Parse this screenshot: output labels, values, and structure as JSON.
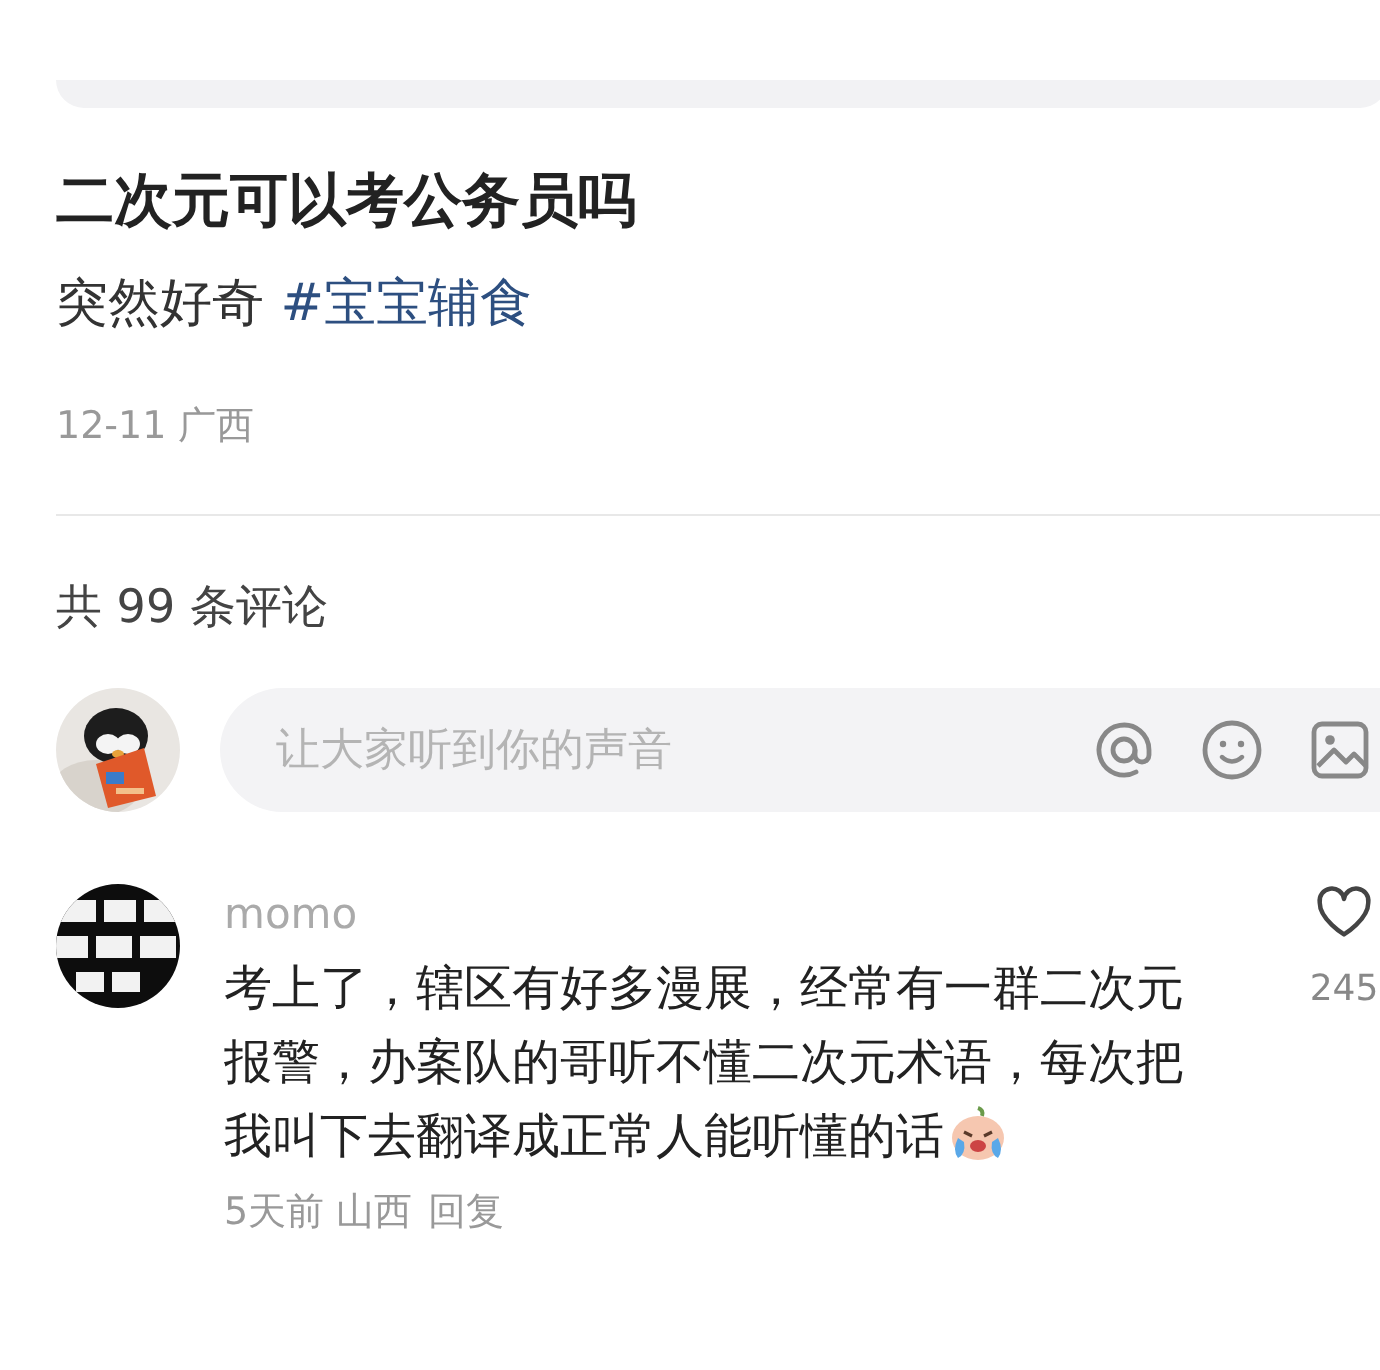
{
  "post": {
    "title": "二次元可以考公务员吗",
    "body": "突然好奇",
    "hashtag": "#宝宝辅食",
    "meta": "12-11 广西"
  },
  "comments_header": "共 99 条评论",
  "composer": {
    "placeholder": "让大家听到你的声音"
  },
  "comments": [
    {
      "user": "momo",
      "text": "考上了，辖区有好多漫展，经常有一群二次元报警，办案队的哥听不懂二次元术语，每次把我叫下去翻译成正常人能听懂的话",
      "emoji": true,
      "meta": "5天前 山西",
      "reply": "回复",
      "likes": "245",
      "liked": false
    }
  ]
}
